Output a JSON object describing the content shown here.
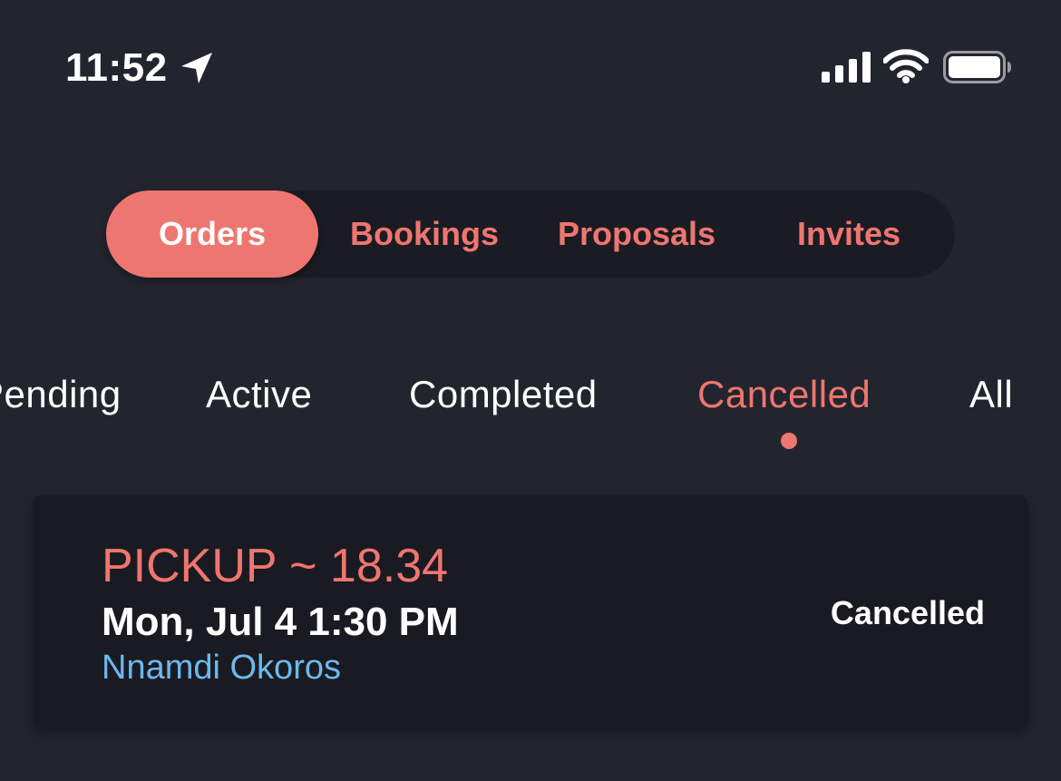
{
  "status_bar": {
    "time": "11:52",
    "icons": [
      "location-arrow-icon",
      "cellular-signal-icon",
      "wifi-icon",
      "battery-icon"
    ]
  },
  "segmented_control": {
    "tabs": [
      {
        "label": "Orders",
        "selected": true
      },
      {
        "label": "Bookings",
        "selected": false
      },
      {
        "label": "Proposals",
        "selected": false
      },
      {
        "label": "Invites",
        "selected": false
      }
    ]
  },
  "filter_tabs": {
    "items": [
      {
        "label": "Pending",
        "selected": false
      },
      {
        "label": "Active",
        "selected": false
      },
      {
        "label": "Completed",
        "selected": false
      },
      {
        "label": "Cancelled",
        "selected": true
      },
      {
        "label": "All",
        "selected": false
      }
    ]
  },
  "orders": [
    {
      "title": "PICKUP ~ 18.34",
      "datetime": "Mon, Jul 4 1:30 PM",
      "customer": "Nnamdi Okoros",
      "status": "Cancelled"
    }
  ],
  "colors": {
    "background": "#23252e",
    "surface": "#1a1b22",
    "accent": "#ee7670",
    "link": "#6cb9ee",
    "text": "#ffffff"
  }
}
